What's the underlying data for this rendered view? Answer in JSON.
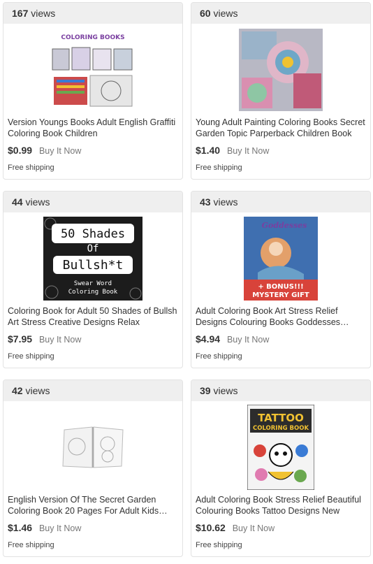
{
  "listings": [
    {
      "views_count": "167",
      "views_label": "views",
      "title": "Version Youngs Books Adult English Graffiti Coloring Book Children",
      "price": "$0.99",
      "format": "Buy It Now",
      "shipping": "Free shipping",
      "image_text": "COLORING BOOKS"
    },
    {
      "views_count": "60",
      "views_label": "views",
      "title": "Young Adult Painting Coloring Books Secret Garden Topic Parperback Children Book",
      "price": "$1.40",
      "format": "Buy It Now",
      "shipping": "Free shipping"
    },
    {
      "views_count": "44",
      "views_label": "views",
      "title": "Coloring Book for Adult 50 Shades of Bullsh Art Stress Creative Designs Relax",
      "price": "$7.95",
      "format": "Buy It Now",
      "shipping": "Free shipping",
      "image_text_1": "50 Shades",
      "image_text_2": "Of",
      "image_text_3": "Bullsh*t",
      "image_text_4": "Swear Word",
      "image_text_5": "Coloring Book"
    },
    {
      "views_count": "43",
      "views_label": "views",
      "title": "Adult Coloring Book Art Stress Relief Designs Colouring Books Goddesses…",
      "price": "$4.94",
      "format": "Buy It Now",
      "shipping": "Free shipping",
      "image_text_1": "Goddesses",
      "image_text_2": "+ BONUS!!!",
      "image_text_3": "MYSTERY GIFT"
    },
    {
      "views_count": "42",
      "views_label": "views",
      "title": "English Version Of The Secret Garden Coloring Book 20 Pages For Adult Kids…",
      "price": "$1.46",
      "format": "Buy It Now",
      "shipping": "Free shipping"
    },
    {
      "views_count": "39",
      "views_label": "views",
      "title": "Adult Coloring Book Stress Relief Beautiful Colouring Books Tattoo Designs New",
      "price": "$10.62",
      "format": "Buy It Now",
      "shipping": "Free shipping",
      "image_text_1": "TATTOO",
      "image_text_2": "COLORING BOOK"
    }
  ]
}
